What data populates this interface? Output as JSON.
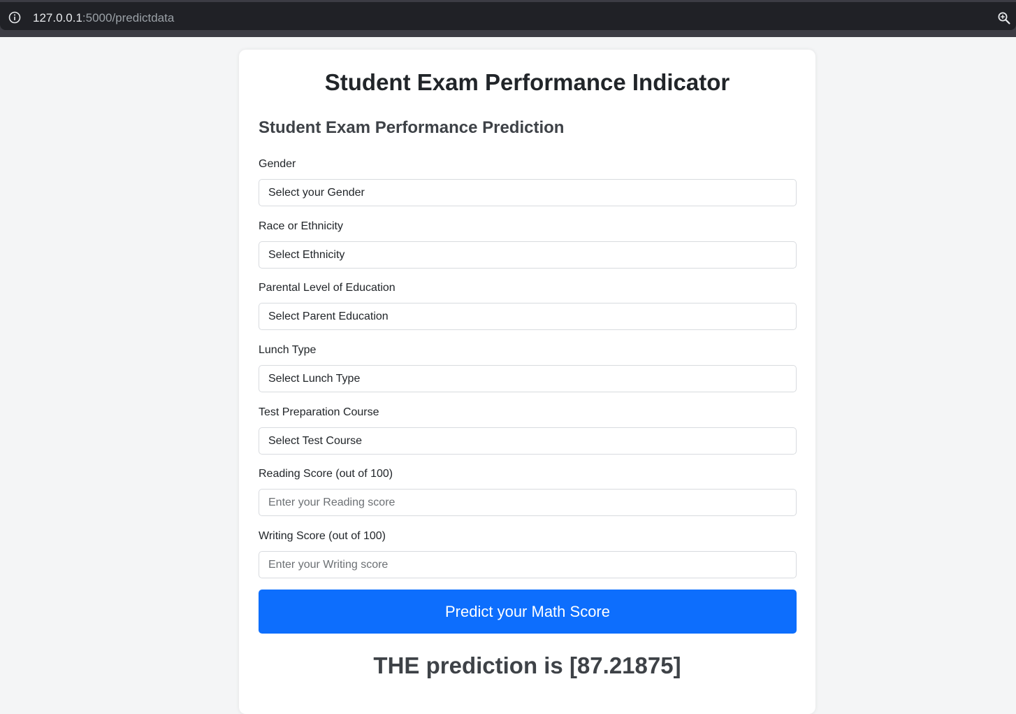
{
  "browser": {
    "url_host": "127.0.0.1",
    "url_path": ":5000/predictdata",
    "icons": {
      "site_info": "info-icon",
      "zoom": "zoom-in-icon"
    }
  },
  "page": {
    "title": "Student Exam Performance Indicator",
    "form_title": "Student Exam Performance Prediction"
  },
  "form": {
    "gender": {
      "label": "Gender",
      "selected": "Select your Gender"
    },
    "ethnicity": {
      "label": "Race or Ethnicity",
      "selected": "Select Ethnicity"
    },
    "parental_education": {
      "label": "Parental Level of Education",
      "selected": "Select Parent Education"
    },
    "lunch": {
      "label": "Lunch Type",
      "selected": "Select Lunch Type"
    },
    "test_course": {
      "label": "Test Preparation Course",
      "selected": "Select Test Course"
    },
    "reading_score": {
      "label": "Reading Score (out of 100)",
      "placeholder": "Enter your Reading score"
    },
    "writing_score": {
      "label": "Writing Score (out of 100)",
      "placeholder": "Enter your Writing score"
    },
    "submit_label": "Predict your Math Score"
  },
  "result": {
    "text": "THE prediction is [87.21875]"
  },
  "colors": {
    "primary": "#0d6efd",
    "page_background": "#f4f5f6",
    "card_background": "#ffffff"
  }
}
